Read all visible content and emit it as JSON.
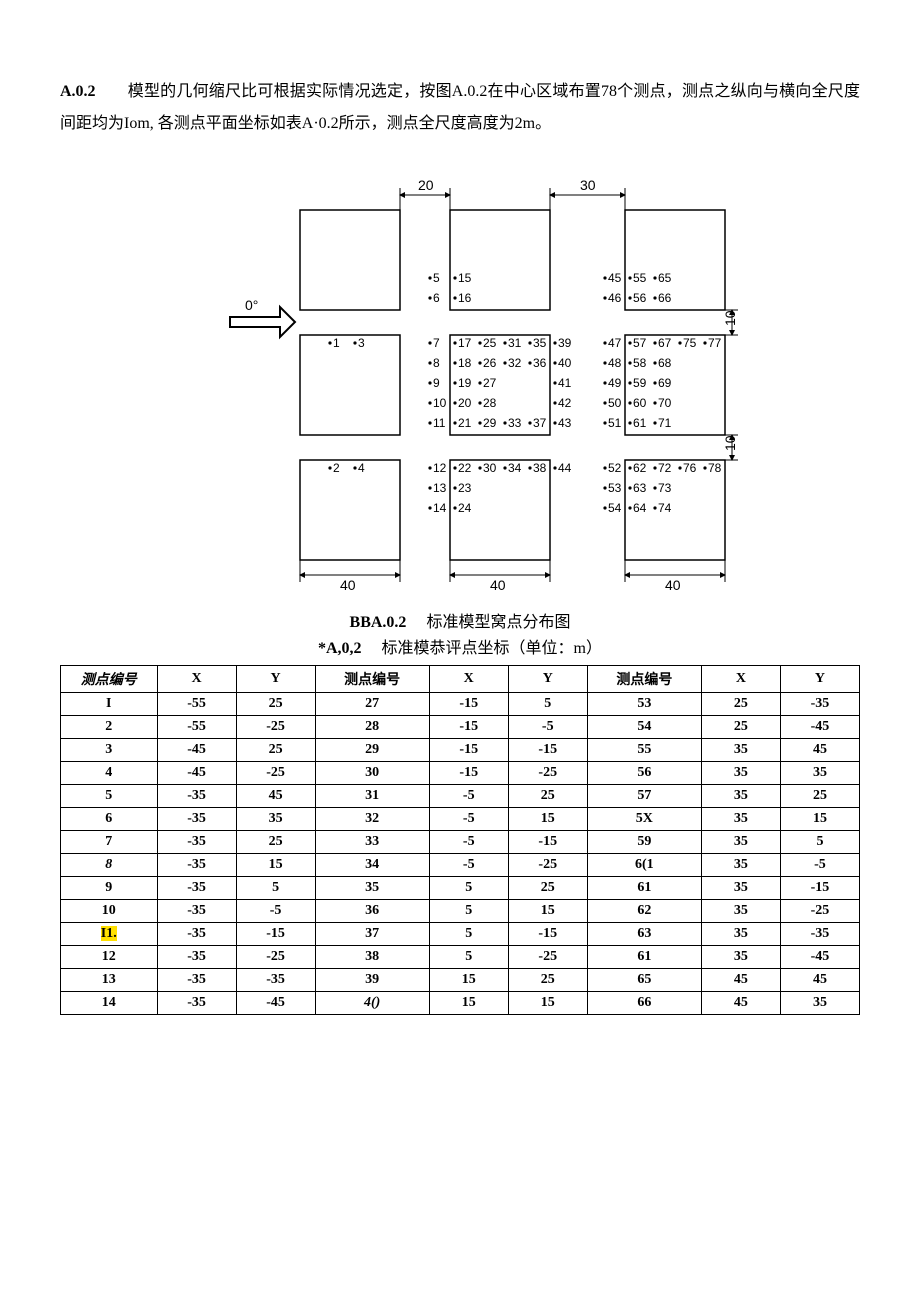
{
  "section_num": "A.0.2",
  "paragraph": "模型的几何缩尺比可根据实际情况选定，按图A.0.2在中心区域布置78个测点，测点之纵向与横向全尺度间距均为Iom, 各测点平面坐标如表A·0.2所示，测点全尺度高度为2m。",
  "diagram": {
    "zero_deg_label": "0°",
    "dim_top_left": "20",
    "dim_top_right": "30",
    "dim_bottom_1": "40",
    "dim_bottom_2": "40",
    "dim_bottom_3": "40",
    "dim_right_1": "10",
    "dim_right_2": "10"
  },
  "captions": {
    "fig_prefix": "BBA.0.2",
    "fig_text": "标准模型窝点分布图",
    "tab_prefix": "*A,0,2",
    "tab_text": "标准模恭评点坐标（单位：m）"
  },
  "headers": {
    "pointnum": "测点编号",
    "x": "X",
    "y": "Y"
  },
  "rows": [
    {
      "a": "I",
      "ax": "-55",
      "ay": "25",
      "b": "27",
      "bx": "-15",
      "by": "5",
      "c": "53",
      "cx": "25",
      "cy": "-35"
    },
    {
      "a": "2",
      "ax": "-55",
      "ay": "-25",
      "b": "28",
      "bx": "-15",
      "by": "-5",
      "c": "54",
      "cx": "25",
      "cy": "-45"
    },
    {
      "a": "3",
      "ax": "-45",
      "ay": "25",
      "b": "29",
      "bx": "-15",
      "by": "-15",
      "c": "55",
      "cx": "35",
      "cy": "45"
    },
    {
      "a": "4",
      "ax": "-45",
      "ay": "-25",
      "b": "30",
      "bx": "-15",
      "by": "-25",
      "c": "56",
      "cx": "35",
      "cy": "35"
    },
    {
      "a": "5",
      "ax": "-35",
      "ay": "45",
      "b": "31",
      "bx": "-5",
      "by": "25",
      "c": "57",
      "cx": "35",
      "cy": "25"
    },
    {
      "a": "6",
      "ax": "-35",
      "ay": "35",
      "b": "32",
      "bx": "-5",
      "by": "15",
      "c": "5X",
      "cx": "35",
      "cy": "15"
    },
    {
      "a": "7",
      "ax": "-35",
      "ay": "25",
      "b": "33",
      "bx": "-5",
      "by": "-15",
      "c": "59",
      "cx": "35",
      "cy": "5"
    },
    {
      "a": "8",
      "ax": "-35",
      "ay": "15",
      "b": "34",
      "bx": "-5",
      "by": "-25",
      "c": "6(1",
      "cx": "35",
      "cy": "-5",
      "aItalic": true
    },
    {
      "a": "9",
      "ax": "-35",
      "ay": "5",
      "b": "35",
      "bx": "5",
      "by": "25",
      "c": "61",
      "cx": "35",
      "cy": "-15"
    },
    {
      "a": "10",
      "ax": "-35",
      "ay": "-5",
      "b": "36",
      "bx": "5",
      "by": "15",
      "c": "62",
      "cx": "35",
      "cy": "-25"
    },
    {
      "a": "I1.",
      "ax": "-35",
      "ay": "-15",
      "b": "37",
      "bx": "5",
      "by": "-15",
      "c": "63",
      "cx": "35",
      "cy": "-35",
      "mark": true
    },
    {
      "a": "12",
      "ax": "-35",
      "ay": "-25",
      "b": "38",
      "bx": "5",
      "by": "-25",
      "c": "61",
      "cx": "35",
      "cy": "-45"
    },
    {
      "a": "13",
      "ax": "-35",
      "ay": "-35",
      "b": "39",
      "bx": "15",
      "by": "25",
      "c": "65",
      "cx": "45",
      "cy": "45"
    },
    {
      "a": "14",
      "ax": "-35",
      "ay": "-45",
      "b": "4()",
      "bx": "15",
      "by": "15",
      "c": "66",
      "cx": "45",
      "cy": "35",
      "bItalic": true
    }
  ]
}
